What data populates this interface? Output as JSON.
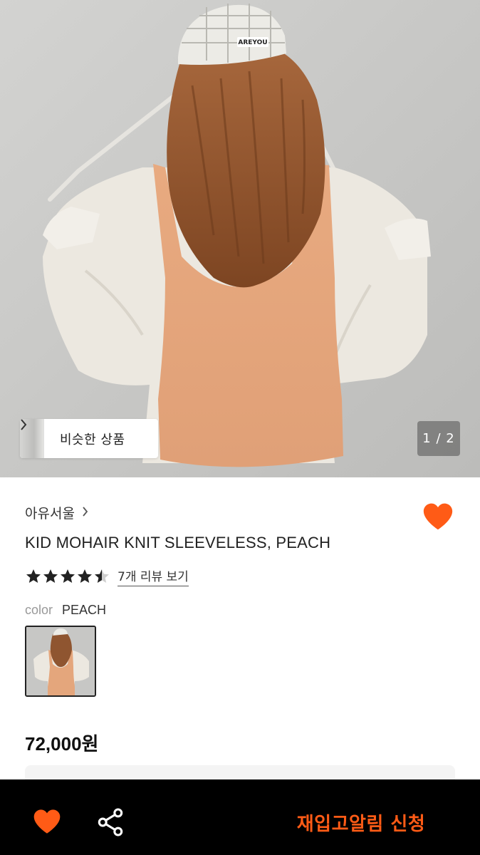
{
  "hero": {
    "similar_products_label": "비슷한 상품",
    "page_counter": "1 / 2",
    "hat_text": "AREYOU"
  },
  "product": {
    "brand": "아유서울",
    "name": "KID MOHAIR KNIT SLEEVELESS, PEACH",
    "rating": 4.5,
    "review_link": "7개 리뷰 보기",
    "color_label": "color",
    "color_value": "PEACH",
    "price": "72,000원",
    "wishlisted": true
  },
  "bottom_bar": {
    "restock_button": "재입고알림 신청"
  },
  "colors": {
    "accent": "#ff5b16",
    "bar_background": "#000000",
    "stars": "#222222"
  },
  "icons": [
    "chevron-right-icon",
    "heart-icon",
    "star-icon",
    "share-icon"
  ]
}
